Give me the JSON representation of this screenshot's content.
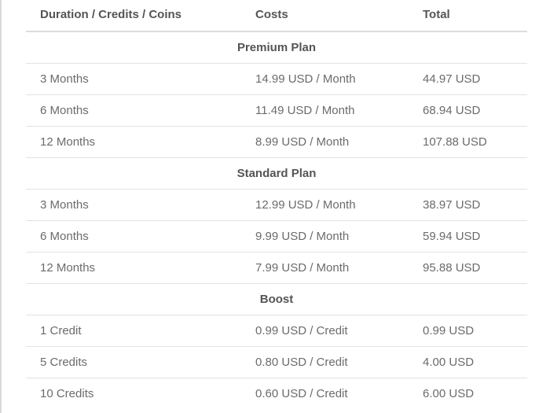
{
  "header": {
    "col1": "Duration / Credits / Coins",
    "col2": "Costs",
    "col3": "Total"
  },
  "sections": [
    {
      "title": "Premium Plan",
      "rows": [
        {
          "duration": "3 Months",
          "cost": "14.99 USD / Month",
          "total": "44.97 USD"
        },
        {
          "duration": "6 Months",
          "cost": "11.49 USD / Month",
          "total": "68.94 USD"
        },
        {
          "duration": "12 Months",
          "cost": "8.99 USD / Month",
          "total": "107.88 USD"
        }
      ]
    },
    {
      "title": "Standard Plan",
      "rows": [
        {
          "duration": "3 Months",
          "cost": "12.99 USD / Month",
          "total": "38.97 USD"
        },
        {
          "duration": "6 Months",
          "cost": "9.99 USD / Month",
          "total": "59.94 USD"
        },
        {
          "duration": "12 Months",
          "cost": "7.99 USD / Month",
          "total": "95.88 USD"
        }
      ]
    },
    {
      "title": "Boost",
      "rows": [
        {
          "duration": "1 Credit",
          "cost": "0.99 USD / Credit",
          "total": "0.99 USD"
        },
        {
          "duration": "5 Credits",
          "cost": "0.80 USD / Credit",
          "total": "4.00 USD"
        },
        {
          "duration": "10 Credits",
          "cost": "0.60 USD / Credit",
          "total": "6.00 USD"
        }
      ]
    }
  ]
}
